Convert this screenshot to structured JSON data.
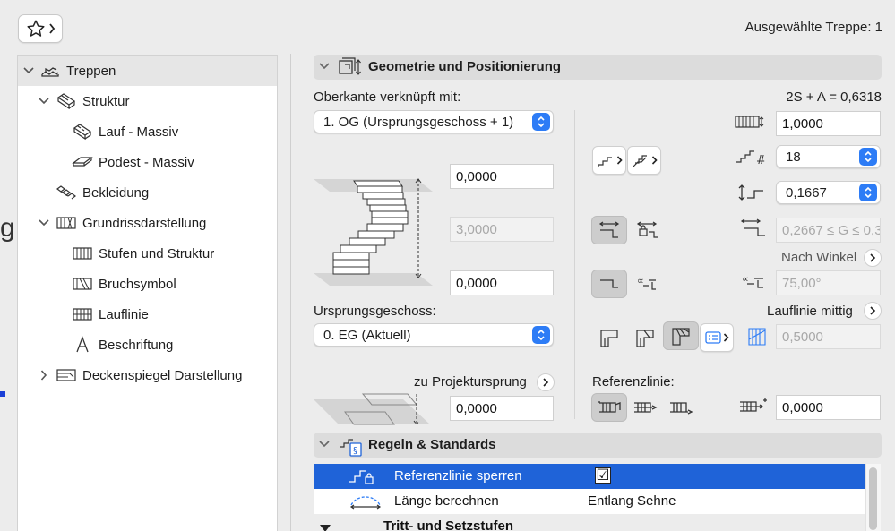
{
  "header": {
    "selected_stair": "Ausgewählte Treppe: 1"
  },
  "tree": {
    "items": [
      {
        "label": "Treppen"
      },
      {
        "label": "Struktur"
      },
      {
        "label": "Lauf - Massiv"
      },
      {
        "label": "Podest - Massiv"
      },
      {
        "label": "Bekleidung"
      },
      {
        "label": "Grundrissdarstellung"
      },
      {
        "label": "Stufen und Struktur"
      },
      {
        "label": "Bruchsymbol"
      },
      {
        "label": "Lauflinie"
      },
      {
        "label": "Beschriftung"
      },
      {
        "label": "Deckenspiegel Darstellung"
      }
    ]
  },
  "left_edge": {
    "glyph": "g"
  },
  "geometry": {
    "title": "Geometrie und Positionierung",
    "top_link_label": "Oberkante verknüpft mit:",
    "top_link_value": "1. OG (Ursprungsgeschoss + 1)",
    "formula": "2S + A = 0,6318",
    "top_offset": "0,0000",
    "height": "3,0000",
    "bottom_offset": "0,0000",
    "home_story_label": "Ursprungsgeschoss:",
    "home_story_value": "0. EG (Aktuell)",
    "project_zero_label": "zu Projektursprung",
    "project_zero_value": "0,0000",
    "flight_width": "1,0000",
    "riser_count": "18",
    "riser_height": "0,1667",
    "going_range": "0,2667 ≤ G ≤ 0,3",
    "by_angle_label": "Nach Winkel",
    "angle_value": "75,00°",
    "walkline_label": "Lauflinie mittig",
    "walkline_value": "0,5000",
    "reference_label": "Referenzlinie:",
    "reference_offset": "0,0000"
  },
  "rules": {
    "title": "Regeln & Standards",
    "rows": [
      {
        "label": "Referenzlinie sperren",
        "value": "☑"
      },
      {
        "label": "Länge berechnen",
        "value": "Entlang Sehne"
      }
    ],
    "subgroup": "Tritt- und Setzstufen"
  },
  "colors": {
    "accent": "#2d7cf6",
    "selection": "#1f63d8",
    "panel_bg": "#ececec",
    "header_bg": "#dcdcdc"
  },
  "icons": {
    "favorites": "star-icon",
    "expand": "chevron-down-icon",
    "collapse": "chevron-right-icon"
  }
}
